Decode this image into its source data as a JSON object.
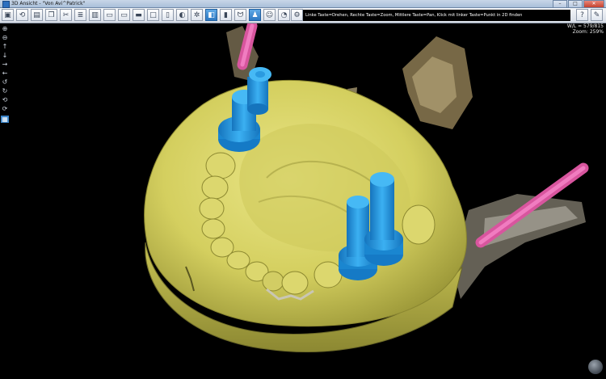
{
  "window": {
    "title": "3D Ansicht - \"Von Avi^Patrick\"",
    "buttons": [
      "–",
      "□",
      "✕"
    ]
  },
  "toolbar": {
    "hint": "Linke Taste=Drehen, Rechte Taste=Zoom, Mittlere Taste=Pan, Klick mit linker Taste=Punkt in 2D finden",
    "help_label": "?"
  },
  "viewport": {
    "wl": "W/L = 579/815",
    "zoom": "Zoom: 259%"
  },
  "colors": {
    "model": "#d8d46a",
    "implant": "#1f8ed6",
    "nerve": "#e05aa6",
    "bone": "#9c8c6c"
  }
}
